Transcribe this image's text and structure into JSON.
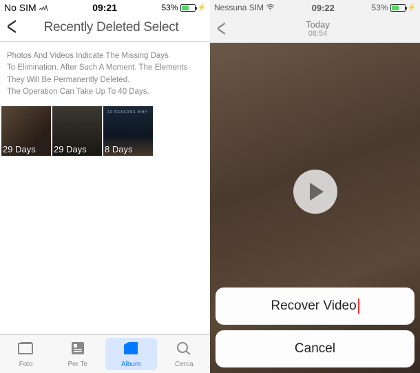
{
  "left": {
    "status": {
      "carrier": "No SIM",
      "time": "09:21",
      "battery_pct": "53%"
    },
    "nav": {
      "title": "Recently Deleted Select"
    },
    "info": {
      "line1": "Photos And Videos Indicate The Missing Days",
      "line2": "To Elimination. After Such A Moment. The Elements",
      "line3": "They Will Be Permanently Deleted.",
      "line4": "The Operation Can Take Up To 40 Days."
    },
    "thumbs": [
      {
        "label": "29 Days"
      },
      {
        "label": "29 Days"
      },
      {
        "label": "8 Days",
        "poster": "13 REASONS WHY"
      }
    ],
    "tabs": {
      "foto": "Foto",
      "perte": "Per Te",
      "album": "Album",
      "cerca": "Cerca"
    }
  },
  "right": {
    "status": {
      "carrier": "Nessuna SIM",
      "time": "09:22",
      "battery_pct": "53%"
    },
    "nav": {
      "title": "Today",
      "subtitle": "08:54"
    },
    "sheet": {
      "recover": "Recover Video",
      "cancel": "Cancel"
    }
  }
}
